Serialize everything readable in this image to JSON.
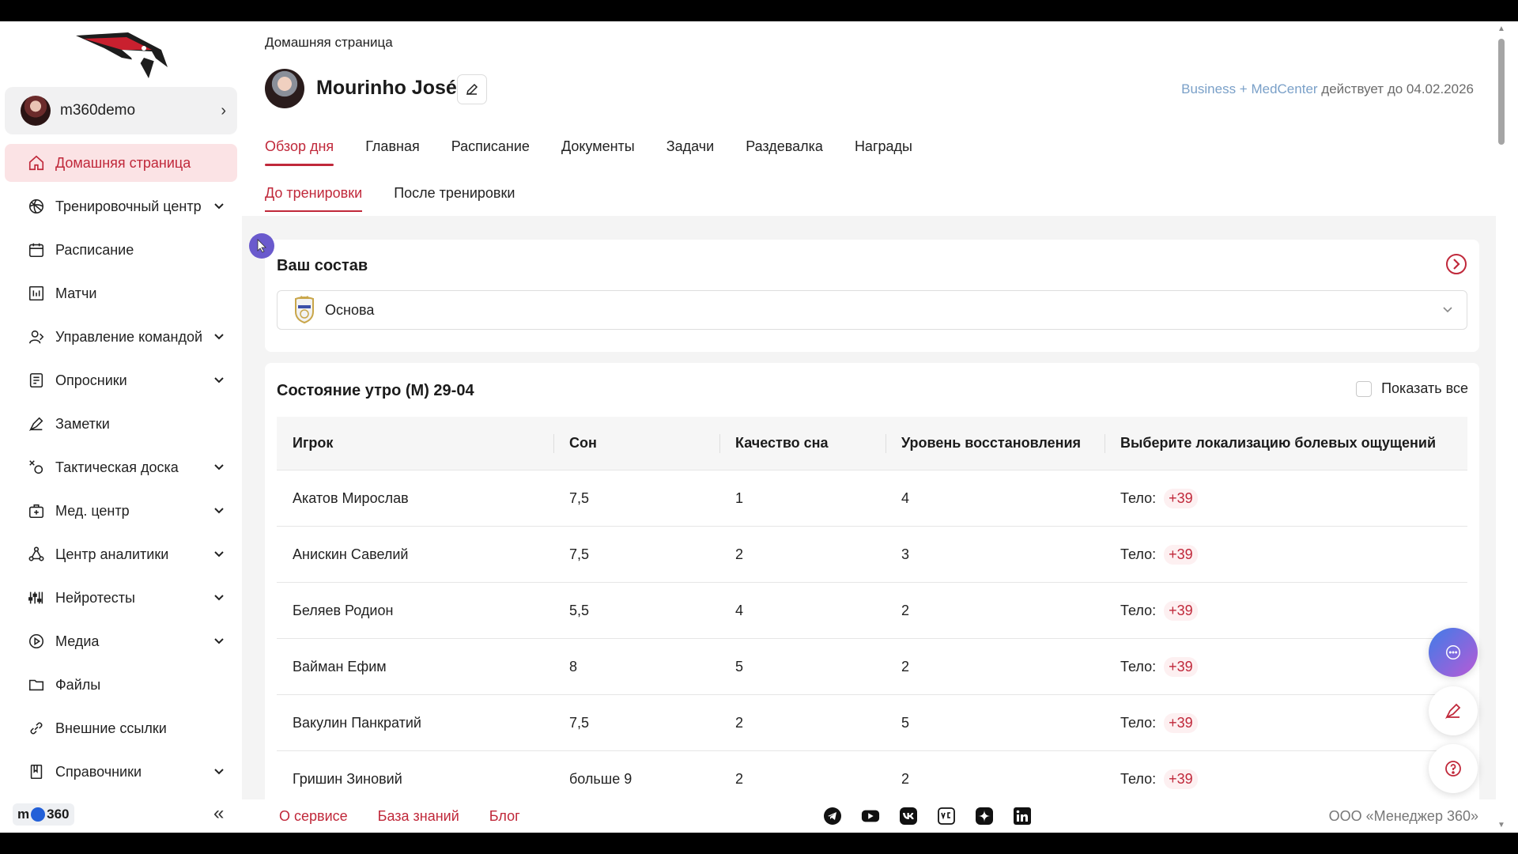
{
  "sidebar": {
    "profile_name": "m360demo",
    "items": [
      {
        "label": "Домашняя страница",
        "icon": "home-icon",
        "active": true,
        "expandable": false
      },
      {
        "label": "Тренировочный центр",
        "icon": "ball-icon",
        "active": false,
        "expandable": true
      },
      {
        "label": "Расписание",
        "icon": "calendar-icon",
        "active": false,
        "expandable": false
      },
      {
        "label": "Матчи",
        "icon": "scoreboard-icon",
        "active": false,
        "expandable": false
      },
      {
        "label": "Управление командой",
        "icon": "team-management-icon",
        "active": false,
        "expandable": true
      },
      {
        "label": "Опросники",
        "icon": "survey-icon",
        "active": false,
        "expandable": true
      },
      {
        "label": "Заметки",
        "icon": "pen-icon",
        "active": false,
        "expandable": false
      },
      {
        "label": "Тактическая доска",
        "icon": "tactics-icon",
        "active": false,
        "expandable": true
      },
      {
        "label": "Мед. центр",
        "icon": "medkit-icon",
        "active": false,
        "expandable": true
      },
      {
        "label": "Центр аналитики",
        "icon": "analytics-icon",
        "active": false,
        "expandable": true
      },
      {
        "label": "Нейротесты",
        "icon": "equalizer-icon",
        "active": false,
        "expandable": true
      },
      {
        "label": "Медиа",
        "icon": "play-icon",
        "active": false,
        "expandable": true
      },
      {
        "label": "Файлы",
        "icon": "folder-icon",
        "active": false,
        "expandable": false
      },
      {
        "label": "Внешние ссылки",
        "icon": "link-icon",
        "active": false,
        "expandable": false
      },
      {
        "label": "Справочники",
        "icon": "book-icon",
        "active": false,
        "expandable": true
      }
    ],
    "brand_prefix": "m",
    "brand_suffix": "360"
  },
  "header": {
    "breadcrumb": "Домашняя страница",
    "user_name": "Mourinho José",
    "license_plan": "Business + MedCenter",
    "license_text": "действует до 04.02.2026"
  },
  "tabs": [
    "Обзор дня",
    "Главная",
    "Расписание",
    "Документы",
    "Задачи",
    "Раздевалка",
    "Награды"
  ],
  "subtabs": [
    "До тренировки",
    "После тренировки"
  ],
  "lineup": {
    "title": "Ваш состав",
    "selected": "Основа"
  },
  "morning_state": {
    "title": "Состояние утро (М) 29-04",
    "show_all_label": "Показать все",
    "columns": [
      "Игрок",
      "Сон",
      "Качество сна",
      "Уровень восстановления",
      "Выберите локализацию болевых ощущений"
    ],
    "rows": [
      {
        "player": "Акатов Мирослав",
        "sleep": "7,5",
        "quality": "1",
        "recovery": "4",
        "body_label": "Тело:",
        "body_count": "+39"
      },
      {
        "player": "Анискин Савелий",
        "sleep": "7,5",
        "quality": "2",
        "recovery": "3",
        "body_label": "Тело:",
        "body_count": "+39"
      },
      {
        "player": "Беляев Родион",
        "sleep": "5,5",
        "quality": "4",
        "recovery": "2",
        "body_label": "Тело:",
        "body_count": "+39"
      },
      {
        "player": "Вайман Ефим",
        "sleep": "8",
        "quality": "5",
        "recovery": "2",
        "body_label": "Тело:",
        "body_count": "+39"
      },
      {
        "player": "Вакулин Панкратий",
        "sleep": "7,5",
        "quality": "2",
        "recovery": "5",
        "body_label": "Тело:",
        "body_count": "+39"
      },
      {
        "player": "Гришин Зиновий",
        "sleep": "больше 9",
        "quality": "2",
        "recovery": "2",
        "body_label": "Тело:",
        "body_count": "+39"
      }
    ]
  },
  "footer": {
    "links": [
      "О сервисе",
      "База знаний",
      "Блог"
    ],
    "socials": [
      "telegram-icon",
      "youtube-icon",
      "vk-icon",
      "vc-icon",
      "dzen-icon",
      "linkedin-icon"
    ],
    "company": "ООО «Менеджер 360»"
  },
  "colors": {
    "accent": "#c0283a",
    "active_bg": "#fbe3e5",
    "plan": "#7aa0c8"
  }
}
